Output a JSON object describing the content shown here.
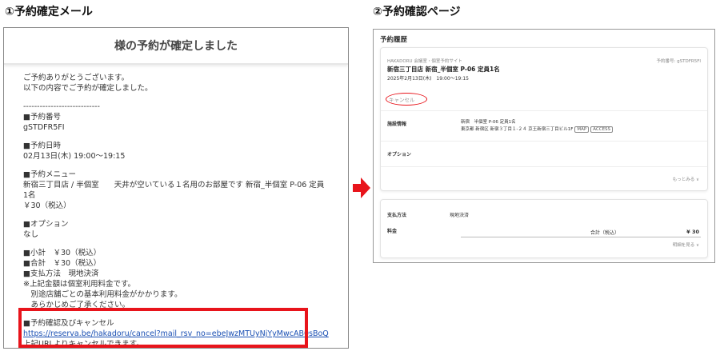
{
  "headings": {
    "email": "①予約確定メール",
    "page": "②予約確認ページ"
  },
  "email": {
    "header": "様の予約が確定しました",
    "greeting": "ご予約ありがとうございます。",
    "confirm_line": "以下の内容でご予約が確定しました。",
    "separator": "----------------------------",
    "number_label": "■予約番号",
    "number_value": "gSTDFR5FI",
    "datetime_label": "■予約日時",
    "datetime_value": "02月13日(木) 19:00～19:15",
    "menu_label": "■予約メニュー",
    "menu_value": "新宿三丁目店 / 半個室　　天井が空いている１名用のお部屋です 新宿_半個室 P-06 定員1名",
    "menu_price": "￥30（税込）",
    "option_label": "■オプション",
    "option_value": "なし",
    "subtotal": "■小計　￥30（税込）",
    "total": "■合計　￥30（税込）",
    "payment": "■支払方法　現地決済",
    "note1": "※上記金額は個室利用料金です。",
    "note2": "　別途店舗ごとの基本利用料金がかかります。",
    "note3": "　あらかじめご了承ください。",
    "confirm_cancel_label": "■予約確認及びキャンセル",
    "cancel_url": "https://reserva.be/hakadoru/cancel?mail_rsv_no=ebeJwzMTUyNjYyMwcAB0sBoQ",
    "cancel_note": "上記URLよりキャンセルできます。"
  },
  "page": {
    "title": "予約履歴",
    "site_name": "HAKADORU 会議室・個室予約サイト",
    "reservation_no": "予約番号: gSTDFR5FI",
    "room_title": "新宿三丁目店 新宿_半個室 P-06 定員1名",
    "datetime": "2025年2月13日(木)　19:00〜19:15",
    "cancel_button": "キャンセル",
    "facility_label": "施設情報",
    "facility_name": "新宿　半個室 P-06 定員1名",
    "facility_address": "東京都 新宿区 新宿３丁目１-２４ 京王新宿三丁目ビル1F",
    "map_label": "MAP",
    "access_label": "ACCESS",
    "option_label": "オプション",
    "more_label": "もっとみる ∨",
    "payment_label": "支払方法",
    "payment_value": "現地決済",
    "fee_label": "料金",
    "total_label": "合計（税込）",
    "total_value": "¥ 30",
    "detail_label": "明細を見る ∨"
  }
}
